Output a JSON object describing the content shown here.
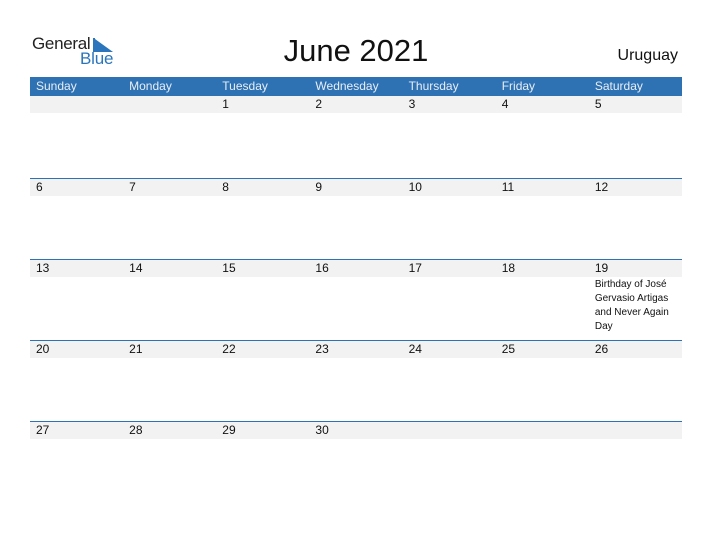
{
  "logo": {
    "line1": "General",
    "line2": "Blue"
  },
  "title": "June 2021",
  "country": "Uruguay",
  "colors": {
    "accent": "#2e72b3",
    "brand_blue": "#2a75bb",
    "date_row_bg": "#f2f2f2"
  },
  "weekdays": [
    "Sunday",
    "Monday",
    "Tuesday",
    "Wednesday",
    "Thursday",
    "Friday",
    "Saturday"
  ],
  "weeks": [
    [
      {
        "day": ""
      },
      {
        "day": ""
      },
      {
        "day": "1"
      },
      {
        "day": "2"
      },
      {
        "day": "3"
      },
      {
        "day": "4"
      },
      {
        "day": "5"
      }
    ],
    [
      {
        "day": "6"
      },
      {
        "day": "7"
      },
      {
        "day": "8"
      },
      {
        "day": "9"
      },
      {
        "day": "10"
      },
      {
        "day": "11"
      },
      {
        "day": "12"
      }
    ],
    [
      {
        "day": "13"
      },
      {
        "day": "14"
      },
      {
        "day": "15"
      },
      {
        "day": "16"
      },
      {
        "day": "17"
      },
      {
        "day": "18"
      },
      {
        "day": "19",
        "event": "Birthday of José Gervasio Artigas and Never Again Day"
      }
    ],
    [
      {
        "day": "20"
      },
      {
        "day": "21"
      },
      {
        "day": "22"
      },
      {
        "day": "23"
      },
      {
        "day": "24"
      },
      {
        "day": "25"
      },
      {
        "day": "26"
      }
    ],
    [
      {
        "day": "27"
      },
      {
        "day": "28"
      },
      {
        "day": "29"
      },
      {
        "day": "30"
      },
      {
        "day": ""
      },
      {
        "day": ""
      },
      {
        "day": ""
      }
    ]
  ]
}
